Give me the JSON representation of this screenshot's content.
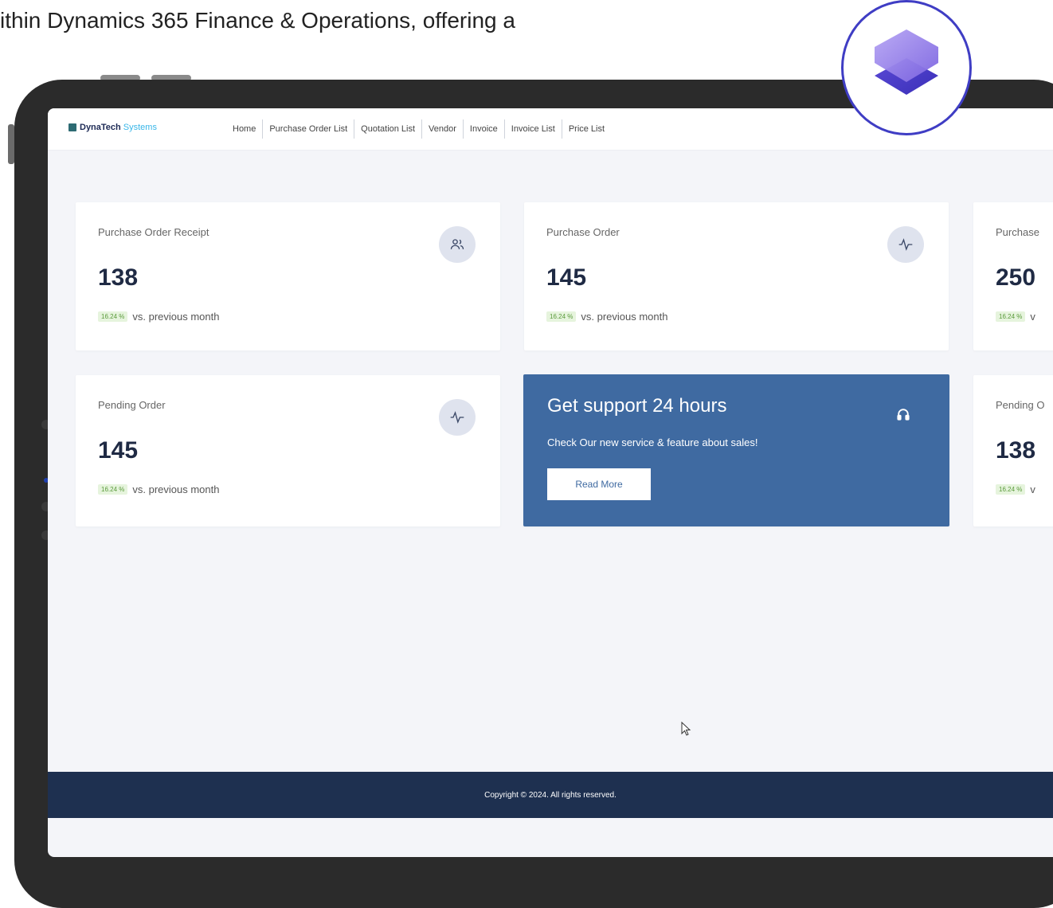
{
  "caption": "ithin Dynamics 365 Finance & Operations, offering a",
  "brand": {
    "name": "DynaTech",
    "sub": "Systems"
  },
  "nav": [
    "Home",
    "Purchase Order List",
    "Quotation List",
    "Vendor",
    "Invoice",
    "Invoice List",
    "Price List"
  ],
  "cards": [
    {
      "label": "Purchase Order Receipt",
      "value": "138",
      "badge": "16.24 %",
      "footer": "vs. previous month",
      "icon": "users-icon"
    },
    {
      "label": "Purchase Order",
      "value": "145",
      "badge": "16.24 %",
      "footer": "vs. previous month",
      "icon": "activity-icon"
    },
    {
      "label": "Purchase",
      "value": "250",
      "badge": "16.24 %",
      "footer": "v",
      "icon": "none"
    },
    {
      "label": "Pending Order",
      "value": "145",
      "badge": "16.24 %",
      "footer": "vs. previous month",
      "icon": "activity-icon"
    },
    {
      "label": "Pending O",
      "value": "138",
      "badge": "16.24 %",
      "footer": "v",
      "icon": "none"
    }
  ],
  "support": {
    "title": "Get support 24 hours",
    "text": "Check Our new service & feature about sales!",
    "button": "Read More",
    "icon": "headset-icon"
  },
  "footer": "Copyright © 2024. All rights reserved.",
  "colors": {
    "accent": "#3f6aa1",
    "footer_bg": "#1e3050",
    "badge_bg": "#e6f4dd",
    "badge_text": "#5a9a3b",
    "logo": "#3f3dc4"
  }
}
